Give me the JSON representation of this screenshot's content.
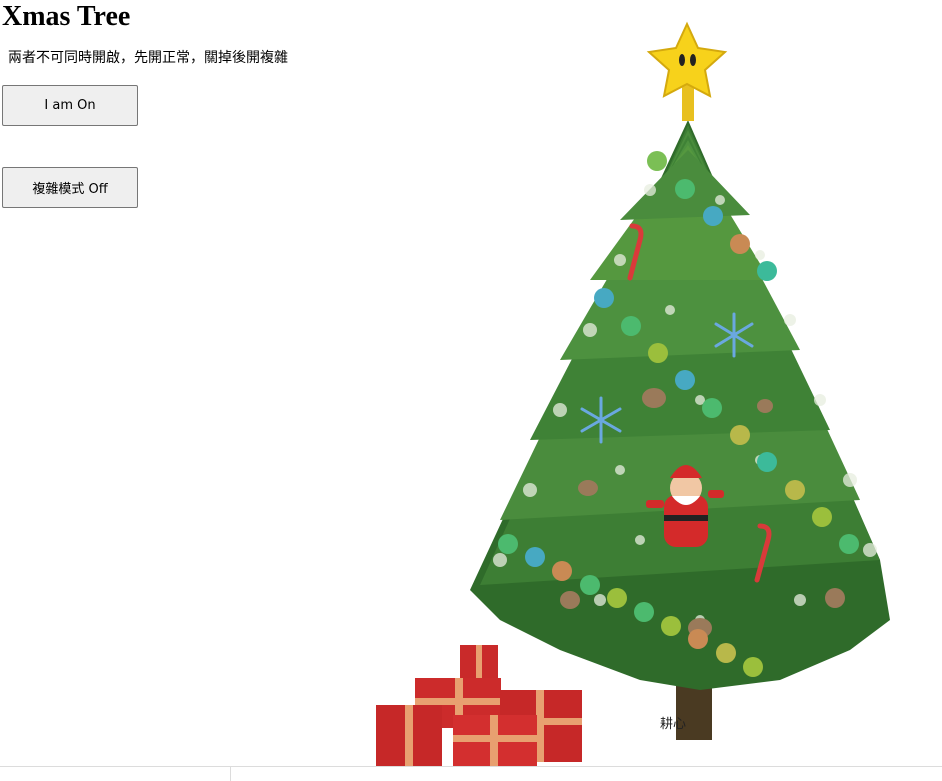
{
  "page": {
    "title": "Xmas Tree",
    "note": "兩者不可同時開啟，先開正常，關掉後開複雜"
  },
  "buttons": {
    "toggle_label": "I am On",
    "complex_label": "複雜模式 Off"
  },
  "tree": {
    "signature": "耕心",
    "light_colors": [
      "#5cb85c",
      "#4aa9c4",
      "#c98a54",
      "#9bbf3c",
      "#3cba9a",
      "#b8b84a"
    ],
    "decorations": [
      "star-icon",
      "candy-cane-icon",
      "snowflake-icon",
      "santa-icon",
      "pinecone-icon",
      "gift-box-icon"
    ]
  }
}
